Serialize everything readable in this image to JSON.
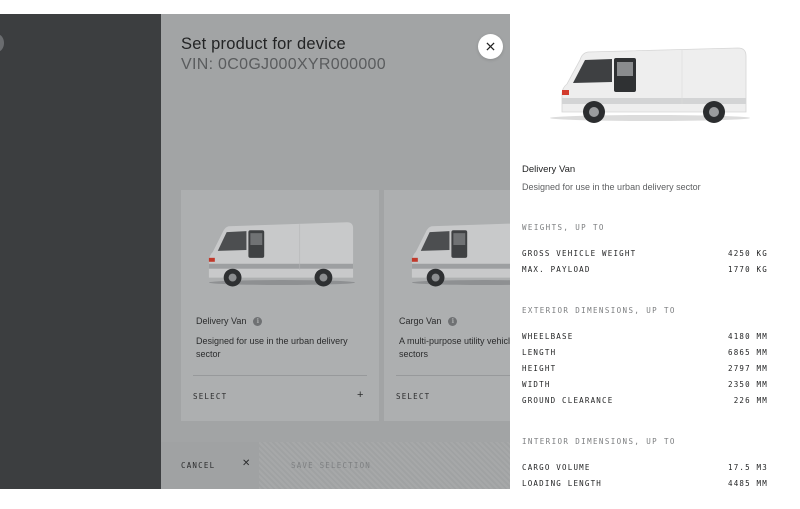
{
  "modal": {
    "title": "Set product for device",
    "vin": "VIN: 0C0GJ000XYR000000"
  },
  "cards": [
    {
      "name": "Delivery Van",
      "description": [
        "Designed for use in the urban delivery",
        "sector"
      ],
      "select_label": "SELECT"
    },
    {
      "name": "Cargo Van",
      "description": [
        "A multi-purpose utility vehicle for",
        "sectors"
      ],
      "select_label": "SELECT"
    }
  ],
  "footer": {
    "cancel_label": "CANCEL",
    "save_label": "SAVE SELECTION"
  },
  "details": {
    "name": "Delivery Van",
    "description": "Designed for use in the urban delivery sector",
    "sections": [
      {
        "title": "WEIGHTS, UP TO",
        "rows": [
          {
            "label": "GROSS VEHICLE WEIGHT",
            "value": "4250 KG"
          },
          {
            "label": "MAX. PAYLOAD",
            "value": "1770 KG"
          }
        ]
      },
      {
        "title": "EXTERIOR DIMENSIONS, UP TO",
        "rows": [
          {
            "label": "WHEELBASE",
            "value": "4180 MM"
          },
          {
            "label": "LENGTH",
            "value": "6865 MM"
          },
          {
            "label": "HEIGHT",
            "value": "2797 MM"
          },
          {
            "label": "WIDTH",
            "value": "2350 MM"
          },
          {
            "label": "GROUND CLEARANCE",
            "value": "226 MM"
          }
        ]
      },
      {
        "title": "INTERIOR DIMENSIONS, UP TO",
        "rows": [
          {
            "label": "CARGO VOLUME",
            "value": "17.5 M3"
          },
          {
            "label": "LOADING LENGTH",
            "value": "4485 MM"
          }
        ]
      }
    ]
  },
  "icons": {
    "close": "close-icon",
    "info": "info-icon",
    "plus": "plus-icon",
    "cancel_x": "close-icon"
  },
  "colors": {
    "overlay": "#a2a4a5",
    "left_rail": "#3c3e40",
    "panel": "#ffffff"
  }
}
